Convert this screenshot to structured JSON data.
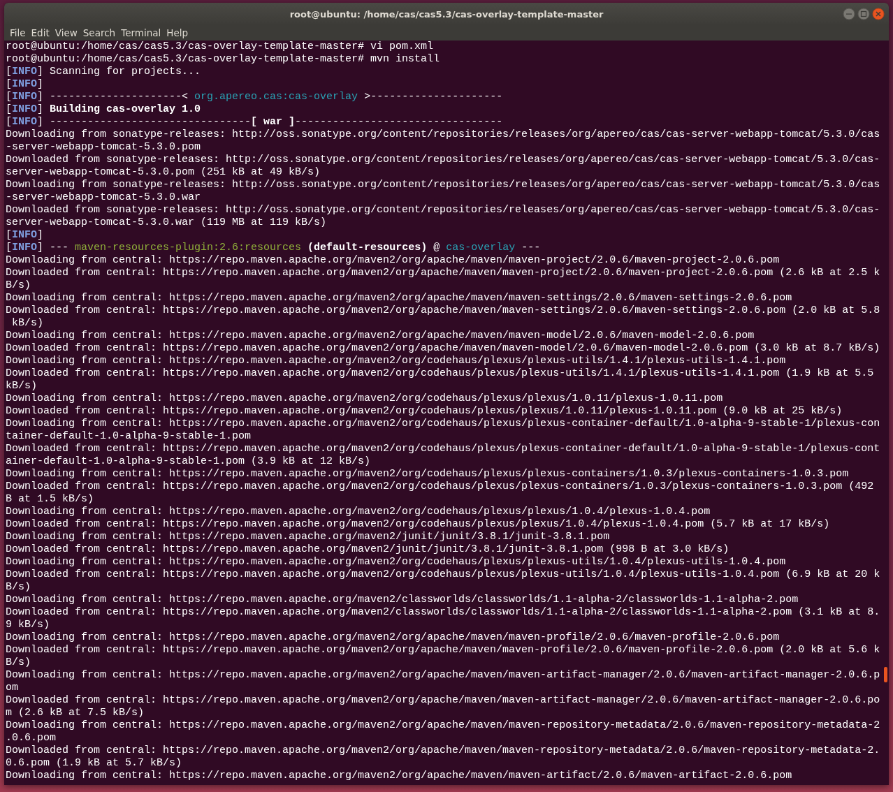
{
  "window": {
    "title": "root@ubuntu: /home/cas/cas5.3/cas-overlay-template-master"
  },
  "menu": [
    "File",
    "Edit",
    "View",
    "Search",
    "Terminal",
    "Help"
  ],
  "lines": [
    {
      "text": "root@ubuntu:/home/cas/cas5.3/cas-overlay-template-master# vi pom.xml"
    },
    {
      "text": "root@ubuntu:/home/cas/cas5.3/cas-overlay-template-master# mvn install"
    },
    {
      "parts": [
        {
          "text": "["
        },
        {
          "text": "INFO",
          "kind": "level"
        },
        {
          "text": "] Scanning for projects..."
        }
      ]
    },
    {
      "parts": [
        {
          "text": "["
        },
        {
          "text": "INFO",
          "kind": "level"
        },
        {
          "text": "]"
        }
      ]
    },
    {
      "parts": [
        {
          "text": "["
        },
        {
          "text": "INFO",
          "kind": "level"
        },
        {
          "text": "] ---------------------< "
        },
        {
          "text": "org.apereo.cas:cas-overlay",
          "kind": "artifact"
        },
        {
          "text": " >---------------------"
        }
      ]
    },
    {
      "parts": [
        {
          "text": "["
        },
        {
          "text": "INFO",
          "kind": "level"
        },
        {
          "text": "] "
        },
        {
          "text": "Building cas-overlay 1.0",
          "kind": "heading"
        }
      ]
    },
    {
      "parts": [
        {
          "text": "["
        },
        {
          "text": "INFO",
          "kind": "level"
        },
        {
          "text": "] --------------------------------"
        },
        {
          "text": "[ war ]",
          "kind": "heading"
        },
        {
          "text": "---------------------------------"
        }
      ]
    },
    {
      "text": "Downloading from sonatype-releases: http://oss.sonatype.org/content/repositories/releases/org/apereo/cas/cas-server-webapp-tomcat/5.3.0/cas"
    },
    {
      "text": "-server-webapp-tomcat-5.3.0.pom"
    },
    {
      "text": "Downloaded from sonatype-releases: http://oss.sonatype.org/content/repositories/releases/org/apereo/cas/cas-server-webapp-tomcat/5.3.0/cas-"
    },
    {
      "text": "server-webapp-tomcat-5.3.0.pom (251 kB at 49 kB/s)"
    },
    {
      "text": "Downloading from sonatype-releases: http://oss.sonatype.org/content/repositories/releases/org/apereo/cas/cas-server-webapp-tomcat/5.3.0/cas"
    },
    {
      "text": "-server-webapp-tomcat-5.3.0.war"
    },
    {
      "text": "Downloaded from sonatype-releases: http://oss.sonatype.org/content/repositories/releases/org/apereo/cas/cas-server-webapp-tomcat/5.3.0/cas-"
    },
    {
      "text": "server-webapp-tomcat-5.3.0.war (119 MB at 119 kB/s)"
    },
    {
      "parts": [
        {
          "text": "["
        },
        {
          "text": "INFO",
          "kind": "level"
        },
        {
          "text": "]"
        }
      ]
    },
    {
      "parts": [
        {
          "text": "["
        },
        {
          "text": "INFO",
          "kind": "level"
        },
        {
          "text": "] --- "
        },
        {
          "text": "maven-resources-plugin:2.6:resources ",
          "kind": "plugin"
        },
        {
          "text": "(default-resources)",
          "kind": "heading"
        },
        {
          "text": " @ "
        },
        {
          "text": "cas-overlay",
          "kind": "artifact"
        },
        {
          "text": " ---"
        }
      ]
    },
    {
      "text": "Downloading from central: https://repo.maven.apache.org/maven2/org/apache/maven/maven-project/2.0.6/maven-project-2.0.6.pom"
    },
    {
      "text": "Downloaded from central: https://repo.maven.apache.org/maven2/org/apache/maven/maven-project/2.0.6/maven-project-2.0.6.pom (2.6 kB at 2.5 k"
    },
    {
      "text": "B/s)"
    },
    {
      "text": "Downloading from central: https://repo.maven.apache.org/maven2/org/apache/maven/maven-settings/2.0.6/maven-settings-2.0.6.pom"
    },
    {
      "text": "Downloaded from central: https://repo.maven.apache.org/maven2/org/apache/maven/maven-settings/2.0.6/maven-settings-2.0.6.pom (2.0 kB at 5.8"
    },
    {
      "text": " kB/s)"
    },
    {
      "text": "Downloading from central: https://repo.maven.apache.org/maven2/org/apache/maven/maven-model/2.0.6/maven-model-2.0.6.pom"
    },
    {
      "text": "Downloaded from central: https://repo.maven.apache.org/maven2/org/apache/maven/maven-model/2.0.6/maven-model-2.0.6.pom (3.0 kB at 8.7 kB/s)"
    },
    {
      "text": "Downloading from central: https://repo.maven.apache.org/maven2/org/codehaus/plexus/plexus-utils/1.4.1/plexus-utils-1.4.1.pom"
    },
    {
      "text": "Downloaded from central: https://repo.maven.apache.org/maven2/org/codehaus/plexus/plexus-utils/1.4.1/plexus-utils-1.4.1.pom (1.9 kB at 5.5"
    },
    {
      "text": "kB/s)"
    },
    {
      "text": "Downloading from central: https://repo.maven.apache.org/maven2/org/codehaus/plexus/plexus/1.0.11/plexus-1.0.11.pom"
    },
    {
      "text": "Downloaded from central: https://repo.maven.apache.org/maven2/org/codehaus/plexus/plexus/1.0.11/plexus-1.0.11.pom (9.0 kB at 25 kB/s)"
    },
    {
      "text": "Downloading from central: https://repo.maven.apache.org/maven2/org/codehaus/plexus/plexus-container-default/1.0-alpha-9-stable-1/plexus-con"
    },
    {
      "text": "tainer-default-1.0-alpha-9-stable-1.pom"
    },
    {
      "text": "Downloaded from central: https://repo.maven.apache.org/maven2/org/codehaus/plexus/plexus-container-default/1.0-alpha-9-stable-1/plexus-cont"
    },
    {
      "text": "ainer-default-1.0-alpha-9-stable-1.pom (3.9 kB at 12 kB/s)"
    },
    {
      "text": "Downloading from central: https://repo.maven.apache.org/maven2/org/codehaus/plexus/plexus-containers/1.0.3/plexus-containers-1.0.3.pom"
    },
    {
      "text": "Downloaded from central: https://repo.maven.apache.org/maven2/org/codehaus/plexus/plexus-containers/1.0.3/plexus-containers-1.0.3.pom (492"
    },
    {
      "text": "B at 1.5 kB/s)"
    },
    {
      "text": "Downloading from central: https://repo.maven.apache.org/maven2/org/codehaus/plexus/plexus/1.0.4/plexus-1.0.4.pom"
    },
    {
      "text": "Downloaded from central: https://repo.maven.apache.org/maven2/org/codehaus/plexus/plexus/1.0.4/plexus-1.0.4.pom (5.7 kB at 17 kB/s)"
    },
    {
      "text": "Downloading from central: https://repo.maven.apache.org/maven2/junit/junit/3.8.1/junit-3.8.1.pom"
    },
    {
      "text": "Downloaded from central: https://repo.maven.apache.org/maven2/junit/junit/3.8.1/junit-3.8.1.pom (998 B at 3.0 kB/s)"
    },
    {
      "text": "Downloading from central: https://repo.maven.apache.org/maven2/org/codehaus/plexus/plexus-utils/1.0.4/plexus-utils-1.0.4.pom"
    },
    {
      "text": "Downloaded from central: https://repo.maven.apache.org/maven2/org/codehaus/plexus/plexus-utils/1.0.4/plexus-utils-1.0.4.pom (6.9 kB at 20 k"
    },
    {
      "text": "B/s)"
    },
    {
      "text": "Downloading from central: https://repo.maven.apache.org/maven2/classworlds/classworlds/1.1-alpha-2/classworlds-1.1-alpha-2.pom"
    },
    {
      "text": "Downloaded from central: https://repo.maven.apache.org/maven2/classworlds/classworlds/1.1-alpha-2/classworlds-1.1-alpha-2.pom (3.1 kB at 8."
    },
    {
      "text": "9 kB/s)"
    },
    {
      "text": "Downloading from central: https://repo.maven.apache.org/maven2/org/apache/maven/maven-profile/2.0.6/maven-profile-2.0.6.pom"
    },
    {
      "text": "Downloaded from central: https://repo.maven.apache.org/maven2/org/apache/maven/maven-profile/2.0.6/maven-profile-2.0.6.pom (2.0 kB at 5.6 k"
    },
    {
      "text": "B/s)"
    },
    {
      "text": "Downloading from central: https://repo.maven.apache.org/maven2/org/apache/maven/maven-artifact-manager/2.0.6/maven-artifact-manager-2.0.6.p"
    },
    {
      "text": "om"
    },
    {
      "text": "Downloaded from central: https://repo.maven.apache.org/maven2/org/apache/maven/maven-artifact-manager/2.0.6/maven-artifact-manager-2.0.6.po"
    },
    {
      "text": "m (2.6 kB at 7.5 kB/s)"
    },
    {
      "text": "Downloading from central: https://repo.maven.apache.org/maven2/org/apache/maven/maven-repository-metadata/2.0.6/maven-repository-metadata-2"
    },
    {
      "text": ".0.6.pom"
    },
    {
      "text": "Downloaded from central: https://repo.maven.apache.org/maven2/org/apache/maven/maven-repository-metadata/2.0.6/maven-repository-metadata-2."
    },
    {
      "text": "0.6.pom (1.9 kB at 5.7 kB/s)"
    },
    {
      "text": "Downloading from central: https://repo.maven.apache.org/maven2/org/apache/maven/maven-artifact/2.0.6/maven-artifact-2.0.6.pom"
    }
  ]
}
